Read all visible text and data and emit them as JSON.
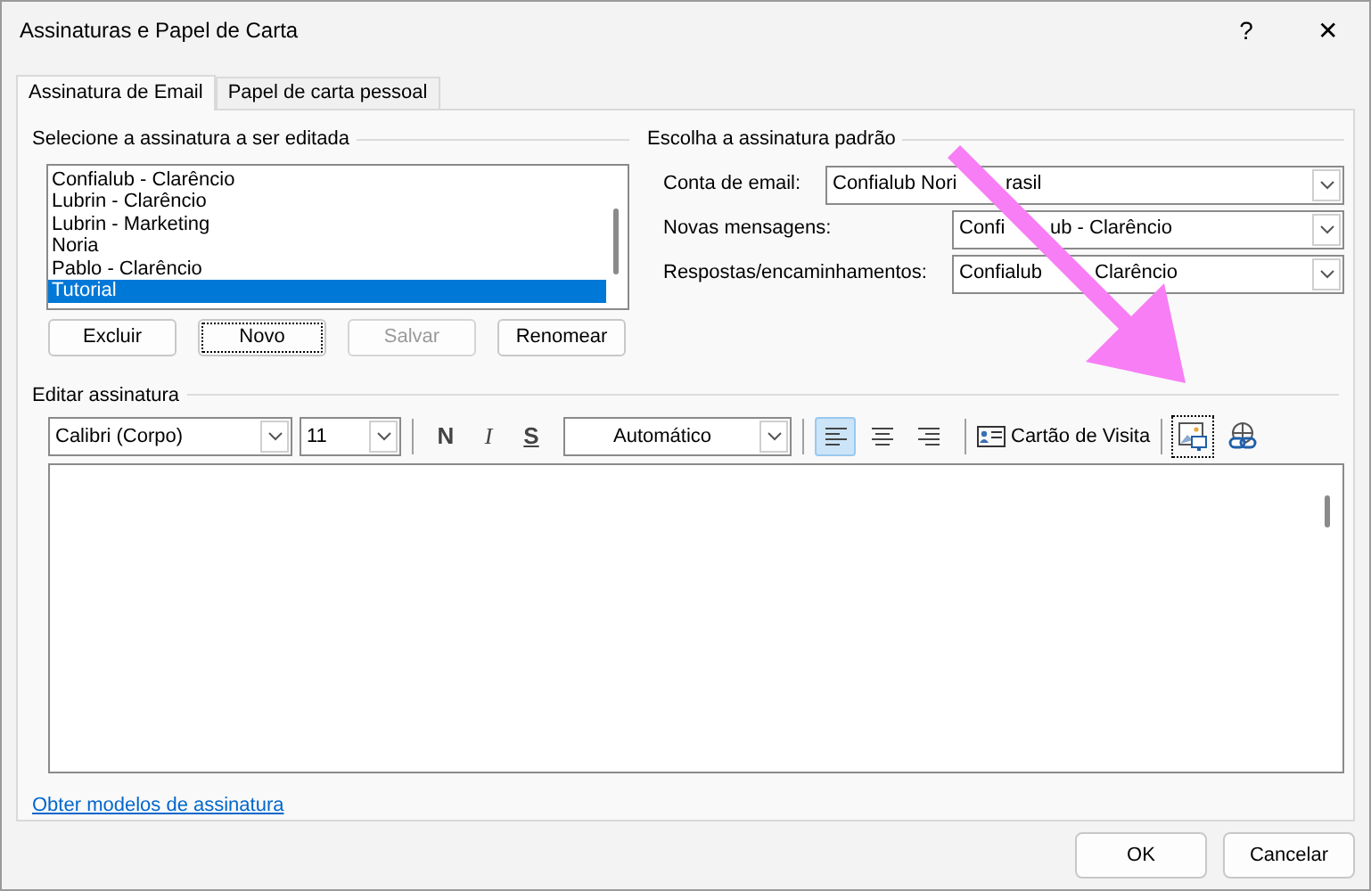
{
  "window": {
    "title": "Assinaturas e Papel de Carta",
    "help": "?",
    "close": "✕"
  },
  "tabs": [
    {
      "label": "Assinatura de Email",
      "selected": true
    },
    {
      "label": "Papel de carta pessoal",
      "selected": false
    }
  ],
  "signature_list": {
    "label": "Selecione a assinatura a ser editada",
    "items": [
      {
        "label": "Confialub - Clarêncio",
        "selected": false
      },
      {
        "label": "Lubrin - Clarêncio",
        "selected": false
      },
      {
        "label": "Lubrin - Marketing",
        "selected": false
      },
      {
        "label": "Noria",
        "selected": false
      },
      {
        "label": "Pablo - Clarêncio",
        "selected": false
      },
      {
        "label": "Tutorial",
        "selected": true
      }
    ],
    "buttons": [
      {
        "label": "Excluir",
        "disabled": false,
        "focused": false
      },
      {
        "label": "Novo",
        "disabled": false,
        "focused": true
      },
      {
        "label": "Salvar",
        "disabled": true,
        "focused": false
      },
      {
        "label": "Renomear",
        "disabled": false,
        "focused": false
      }
    ]
  },
  "default_signature": {
    "label": "Escolha a assinatura padrão",
    "fields": [
      {
        "label": "Conta de email:",
        "value_parts": [
          "Confialub Nori",
          "rasil"
        ]
      },
      {
        "label": "Novas mensagens:",
        "value_parts": [
          "Confi",
          "ub - Clarêncio"
        ]
      },
      {
        "label": "Respostas/encaminhamentos:",
        "value_parts": [
          "Confialub",
          "Clarêncio"
        ]
      }
    ]
  },
  "editor": {
    "label": "Editar assinatura",
    "font": "Calibri (Corpo)",
    "size": "11",
    "format_buttons": [
      "N",
      "I",
      "S"
    ],
    "font_color": "Automático",
    "alignments": [
      {
        "kind": "left",
        "selected": true
      },
      {
        "kind": "center",
        "selected": false
      },
      {
        "kind": "right",
        "selected": false
      }
    ],
    "business_card": "Cartão de Visita",
    "tools": [
      {
        "kind": "picture",
        "focused": true
      },
      {
        "kind": "link",
        "focused": false
      }
    ]
  },
  "link": "Obter modelos de assinatura",
  "dialog_buttons": [
    "OK",
    "Cancelar"
  ]
}
